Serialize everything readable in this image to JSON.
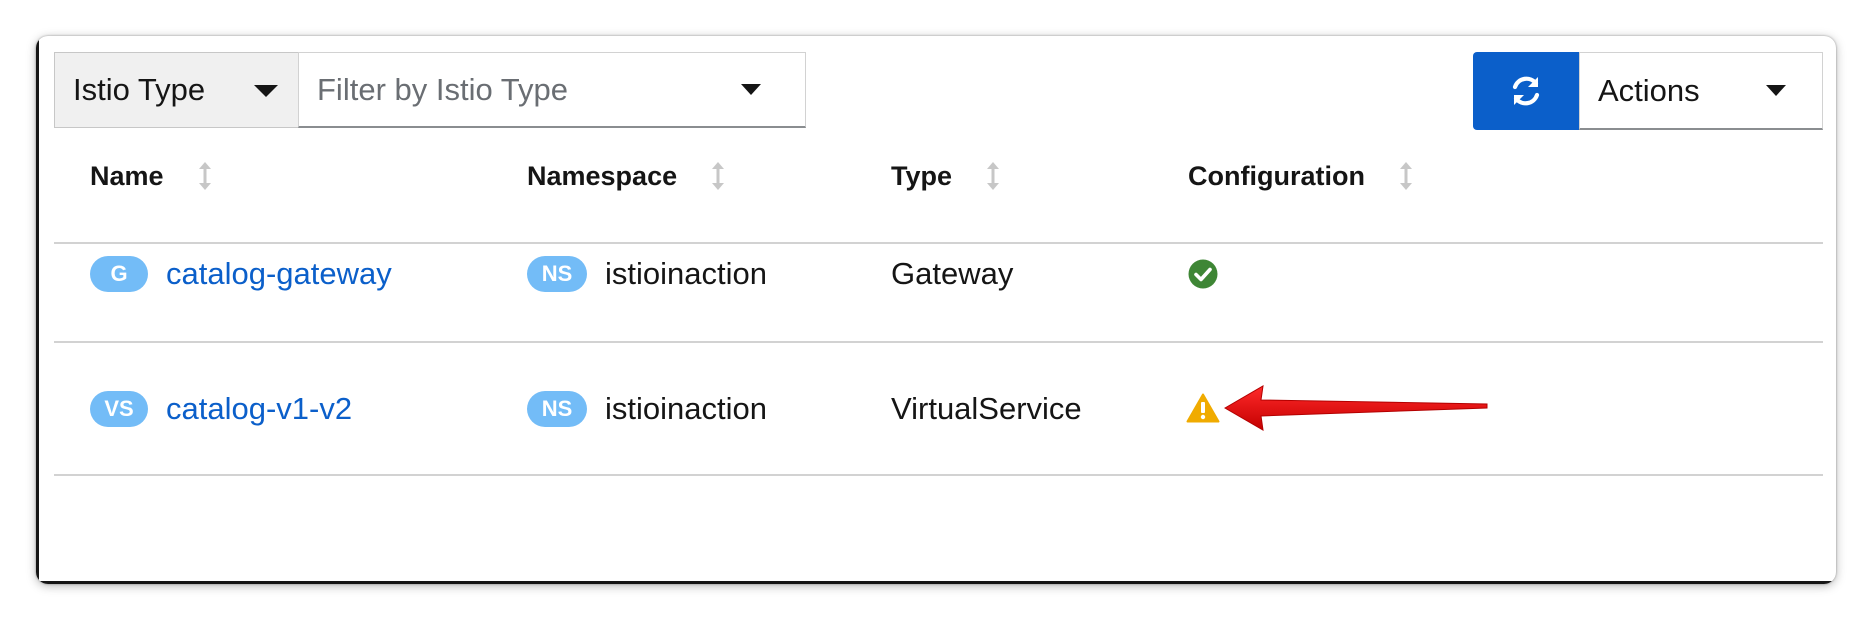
{
  "toolbar": {
    "type_select_label": "Istio Type",
    "filter_placeholder": "Filter by Istio Type",
    "actions_label": "Actions"
  },
  "table": {
    "columns": [
      "Name",
      "Namespace",
      "Type",
      "Configuration"
    ],
    "rows": [
      {
        "name_badge": "G",
        "name": "catalog-gateway",
        "namespace_badge": "NS",
        "namespace": "istioinaction",
        "type": "Gateway",
        "configuration_icon": "check-circle-icon",
        "configuration_status": "valid"
      },
      {
        "name_badge": "VS",
        "name": "catalog-v1-v2",
        "namespace_badge": "NS",
        "namespace": "istioinaction",
        "type": "VirtualService",
        "configuration_icon": "warning-triangle-icon",
        "configuration_status": "warning"
      }
    ]
  },
  "colors": {
    "primary": "#0b5fca",
    "badge": "#73bcf7",
    "success": "#3e8635",
    "warning": "#f0ab00",
    "annotation_arrow": "#e0000a"
  }
}
